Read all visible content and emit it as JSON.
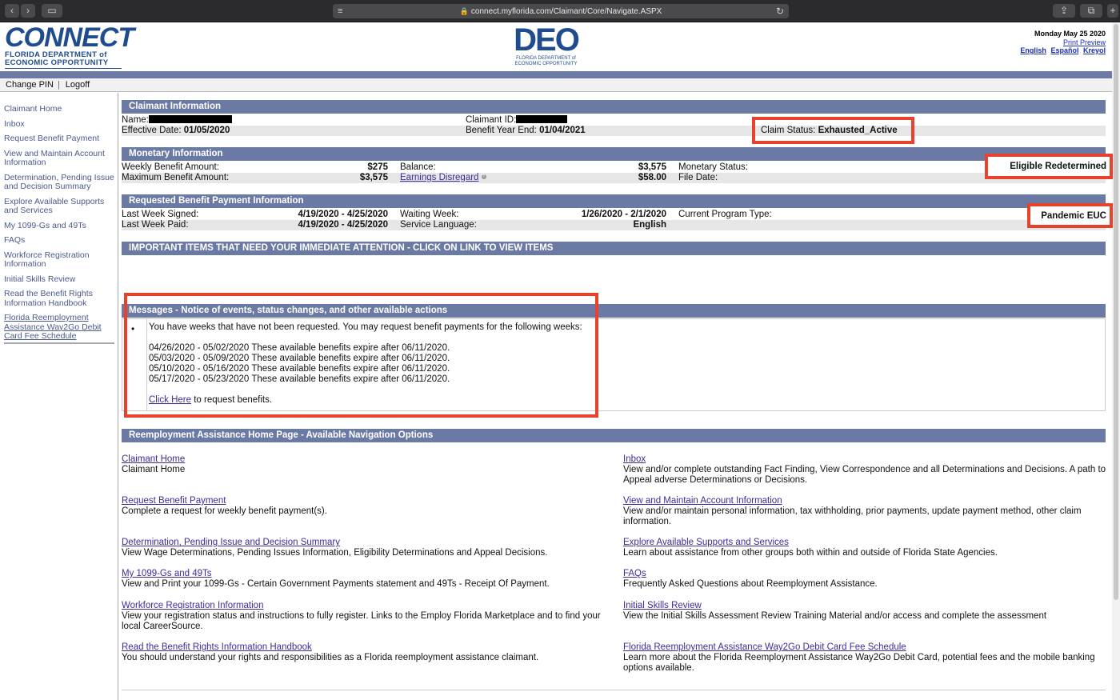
{
  "browser": {
    "url": "connect.myflorida.com/Claimant/Core/Navigate.ASPX"
  },
  "header": {
    "connect_logo_text": "CONNECT",
    "connect_logo_sub1": "FLORIDA DEPARTMENT of",
    "connect_logo_sub2": "ECONOMIC OPPORTUNITY",
    "deo_logo_text": "DEO",
    "deo_logo_sub1": "FLORIDA DEPARTMENT of",
    "deo_logo_sub2": "ECONOMIC OPPORTUNITY",
    "date": "Monday May 25 2020",
    "print_preview": "Print Preview",
    "languages": [
      "English",
      "Español",
      "Kreyol"
    ]
  },
  "menubar": {
    "change_pin": "Change PIN",
    "logoff": "Logoff"
  },
  "sidebar": {
    "items": [
      "Claimant Home",
      "Inbox",
      "Request Benefit Payment",
      "View and Maintain Account Information",
      "Determination, Pending Issue and Decision Summary",
      "Explore Available Supports and Services",
      "My 1099-Gs and 49Ts",
      "FAQs",
      "Workforce Registration Information",
      "Initial Skills Review",
      "Read the Benefit Rights Information Handbook",
      "Florida Reemployment Assistance Way2Go Debit Card Fee Schedule"
    ]
  },
  "claimant_info": {
    "title": "Claimant Information",
    "name_label": "Name:",
    "claimant_id_label": "Claimant ID:",
    "effective_date_label": "Effective Date:",
    "effective_date": "01/05/2020",
    "benefit_year_end_label": "Benefit Year End:",
    "benefit_year_end": "01/04/2021",
    "claim_status_label": "Claim Status:",
    "claim_status": "Exhausted_Active"
  },
  "monetary_info": {
    "title": "Monetary Information",
    "weekly_benefit_label": "Weekly Benefit Amount:",
    "weekly_benefit": "$275",
    "max_benefit_label": "Maximum Benefit Amount:",
    "max_benefit": "$3,575",
    "balance_label": "Balance:",
    "balance": "$3,575",
    "earnings_disregard_label": "Earnings Disregard",
    "earnings_disregard": "$58.00",
    "monetary_status_label": "Monetary Status:",
    "monetary_status": "Eligible Redetermined",
    "file_date_label": "File Date:"
  },
  "payment_info": {
    "title": "Requested Benefit Payment Information",
    "last_week_signed_label": "Last Week Signed:",
    "last_week_signed": "4/19/2020 - 4/25/2020",
    "last_week_paid_label": "Last Week Paid:",
    "last_week_paid": "4/19/2020 - 4/25/2020",
    "waiting_week_label": "Waiting Week:",
    "waiting_week": "1/26/2020 - 2/1/2020",
    "service_language_label": "Service Language:",
    "service_language": "English",
    "program_type_label": "Current Program Type:",
    "program_type": "Pandemic EUC"
  },
  "important": {
    "title": "IMPORTANT ITEMS THAT NEED YOUR IMMEDIATE ATTENTION - CLICK ON LINK TO VIEW ITEMS"
  },
  "messages": {
    "title": "Messages - Notice of events, status changes, and other available actions",
    "intro": "You have weeks that have not been requested. You may request benefit payments for the following weeks:",
    "weeks": [
      "04/26/2020 - 05/02/2020 These available benefits expire after 06/11/2020.",
      "05/03/2020 - 05/09/2020 These available benefits expire after 06/11/2020.",
      "05/10/2020 - 05/16/2020 These available benefits expire after 06/11/2020.",
      "05/17/2020 - 05/23/2020 These available benefits expire after 06/11/2020."
    ],
    "click_here": "Click Here",
    "click_here_suffix": " to request benefits."
  },
  "navigation": {
    "title": "Reemployment Assistance Home Page - Available Navigation Options",
    "left": [
      {
        "link": "Claimant Home",
        "desc": "Claimant Home"
      },
      {
        "link": "Request Benefit Payment",
        "desc": "Complete a request for weekly benefit payment(s)."
      },
      {
        "link": "Determination, Pending Issue and Decision Summary",
        "desc": "View Wage Determinations, Pending Issues Information, Eligibility Determinations and Appeal Decisions."
      },
      {
        "link": "My 1099-Gs and 49Ts",
        "desc": "View and Print your 1099-Gs - Certain Government Payments statement and 49Ts - Receipt Of Payment."
      },
      {
        "link": "Workforce Registration Information",
        "desc": "View your registration status and instructions to fully register. Links to the Employ Florida Marketplace and to find your local CareerSource."
      },
      {
        "link": "Read the Benefit Rights Information Handbook",
        "desc": "You should understand your rights and responsibilities as a Florida reemployment assistance claimant."
      }
    ],
    "right": [
      {
        "link": "Inbox",
        "desc": "View and/or complete outstanding Fact Finding, View Correspondence and all Determinations and Decisions. A path to Appeal adverse Determinations or Decisions."
      },
      {
        "link": "View and Maintain Account Information",
        "desc": "View and/or maintain personal information, tax withholding, prior payments, update payment method, other claim information."
      },
      {
        "link": "Explore Available Supports and Services",
        "desc": "Learn about assistance from other groups both within and outside of Florida State Agencies."
      },
      {
        "link": "FAQs",
        "desc": "Frequently Asked Questions about Reemployment Assistance."
      },
      {
        "link": "Initial Skills Review",
        "desc": "View the Initial Skills Assessment Review Training Material and/or access and complete the assessment"
      },
      {
        "link": "Florida Reemployment Assistance Way2Go Debit Card Fee Schedule",
        "desc": "Learn more about the Florida Reemployment Assistance Way2Go Debit Card, potential fees and the mobile banking options available."
      }
    ]
  },
  "colors": {
    "section_header": "#6b7aa5",
    "highlight_box": "#e8422c",
    "link": "#3b2d9b"
  }
}
